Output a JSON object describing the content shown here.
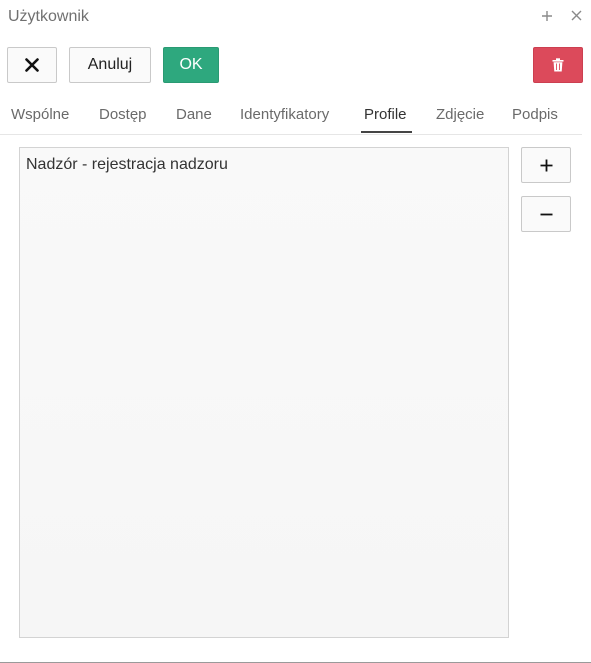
{
  "window": {
    "title": "Użytkownik",
    "add_icon": "plus-icon",
    "close_icon": "close-icon"
  },
  "toolbar": {
    "close_icon": "x-icon",
    "cancel_label": "Anuluj",
    "ok_label": "OK",
    "delete_icon": "trash-icon",
    "ok_color": "#2ea87e",
    "delete_color": "#dc4a5b"
  },
  "tabs": [
    {
      "label": "Wspólne"
    },
    {
      "label": "Dostęp"
    },
    {
      "label": "Dane"
    },
    {
      "label": "Identyfikatory"
    },
    {
      "label": "Profile",
      "active": true
    },
    {
      "label": "Zdjęcie"
    },
    {
      "label": "Podpis"
    }
  ],
  "profiles": {
    "items": [
      {
        "label": "Nadzór - rejestracja nadzoru"
      }
    ],
    "add_icon": "plus-icon",
    "remove_icon": "minus-icon"
  }
}
